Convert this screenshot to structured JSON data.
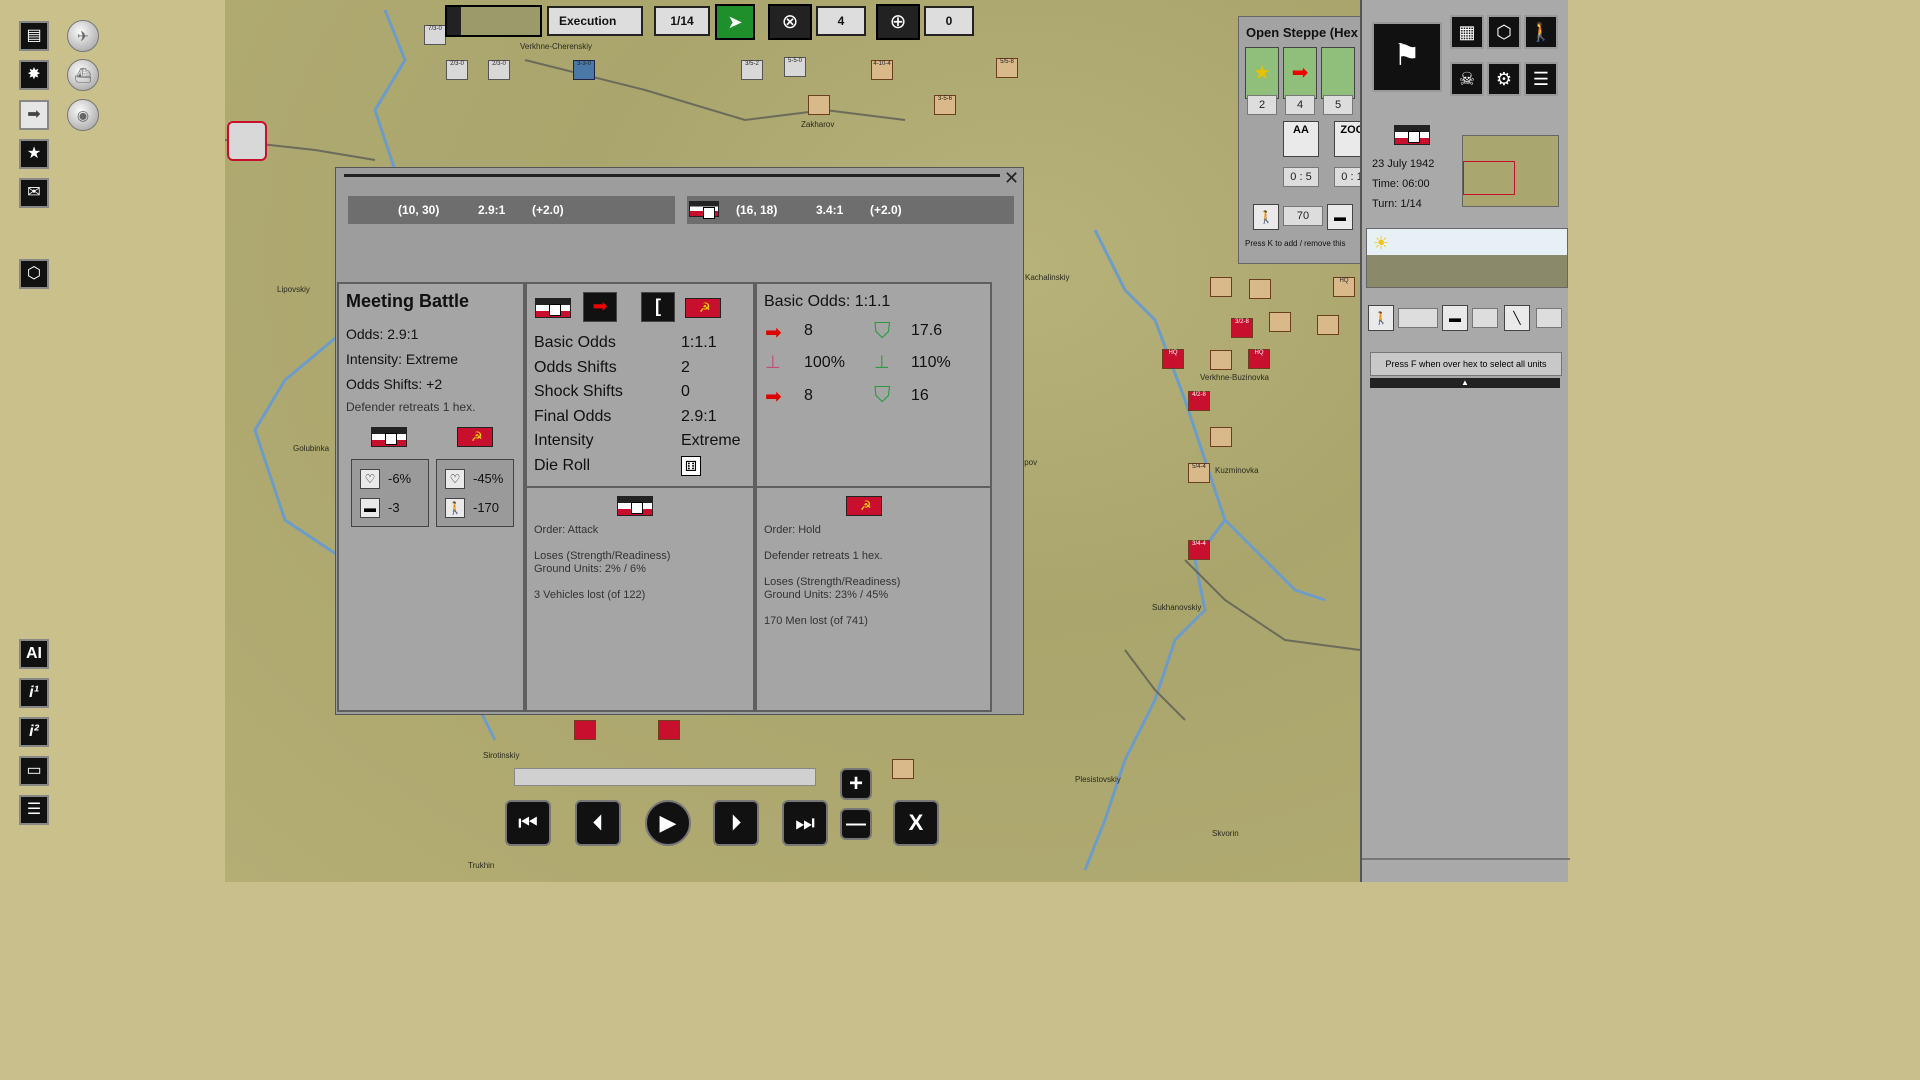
{
  "top_bar": {
    "phase": "Execution",
    "turn": "1/14",
    "targets_count": "4",
    "crosshair_count": "0"
  },
  "map": {
    "towns": [
      "Verkhne-Cherenskiy",
      "Zakharov",
      "Lipovskiy",
      "Golubinka",
      "Sirotinskiy",
      "Kachalinskiy",
      "Lipov",
      "Skvorin",
      "Plesistovskiy",
      "Sukhanovskiy",
      "Trukhin",
      "Skvorin",
      "Verkhne-Buzinovka",
      "Kuzminovka"
    ],
    "counters": [
      "7/3-0",
      "2/3-0",
      "2/3-0",
      "3-3-0",
      "3/5-2",
      "5-5-0",
      "4-10-4",
      "3-5-6",
      "5/5-8",
      "HQ",
      "3/2-8",
      "4/2-8",
      "5/4-4",
      "3/4-4",
      "HQ",
      "HQ",
      "10-0",
      "HQ"
    ]
  },
  "dialog": {
    "close_label": "✕",
    "attacker_bar": {
      "coord": "(10, 30)",
      "odds": "2.9:1",
      "shift": "(+2.0)"
    },
    "defender_bar": {
      "coord": "(16, 18)",
      "odds": "3.4:1",
      "shift": "(+2.0)"
    },
    "summary": {
      "title": "Meeting Battle",
      "odds": "Odds: 2.9:1",
      "intensity": "Intensity: Extreme",
      "shifts": "Odds Shifts: +2",
      "retreat": "Defender retreats 1 hex.",
      "att_strength": "-6%",
      "att_vehicles": "-3",
      "def_strength": "-45%",
      "def_men": "-170"
    },
    "odds_table": {
      "rows": [
        {
          "label": "Basic Odds",
          "value": "1:1.1"
        },
        {
          "label": "Odds Shifts",
          "value": "2"
        },
        {
          "label": "Shock Shifts",
          "value": "0"
        },
        {
          "label": "Final Odds",
          "value": "2.9:1"
        },
        {
          "label": "Intensity",
          "value": "Extreme"
        },
        {
          "label": "Die Roll",
          "value": ""
        }
      ]
    },
    "basic_odds": {
      "title": "Basic Odds: 1:1.1",
      "attack": "8",
      "defense": "17.6",
      "att_org": "100%",
      "def_org": "110%",
      "att_mod": "8",
      "def_mod": "16"
    },
    "attacker_result": {
      "order": "Order: Attack",
      "loses_title": "Loses (Strength/Readiness)",
      "ground": "Ground Units: 2% / 6%",
      "lost": "3 Vehicles lost (of 122)"
    },
    "defender_result": {
      "order": "Order: Hold",
      "retreat": "Defender retreats 1 hex.",
      "loses_title": "Loses (Strength/Readiness)",
      "ground": "Ground Units: 23% / 45%",
      "lost": "170 Men lost (of 741)"
    }
  },
  "hex_info": {
    "title": "Open Steppe (Hex",
    "slots": [
      "2",
      "4",
      "5"
    ],
    "aa_label": "AA",
    "zoc_label": "ZOC",
    "aa_value": "0 : 5",
    "zoc_value": "0 : 1",
    "men": "70",
    "hint": "Press K to add / remove this"
  },
  "right_panel": {
    "date": "23 July 1942",
    "time": "Time: 06:00",
    "turn": "Turn: 1/14",
    "select_hint": "Press F when over hex to select all units"
  },
  "left_bar": {
    "ai_label": "AI",
    "info1_label": "i¹",
    "info2_label": "i²"
  },
  "playback": {
    "zoom_in": "+",
    "zoom_out": "—",
    "close": "X"
  },
  "colors": {
    "map_bg": "#b0aa72",
    "panel_gray": "#a5a5a5",
    "soviet_red": "#c8102e",
    "german_tan": "#d9b98a"
  }
}
